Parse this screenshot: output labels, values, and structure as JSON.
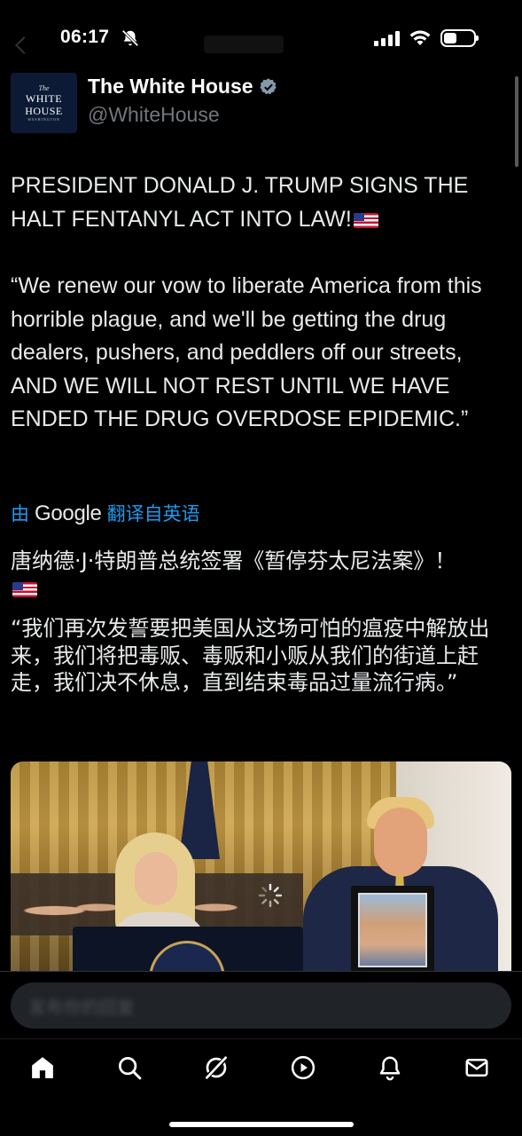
{
  "status_bar": {
    "time": "06:17",
    "icons": [
      "bell-off-icon",
      "signal-icon",
      "wifi-icon",
      "battery-icon"
    ]
  },
  "post": {
    "author": {
      "name": "The White House",
      "handle": "@WhiteHouse",
      "verified": true,
      "avatar_logo": {
        "line1": "The",
        "line2": "WHITE",
        "line3": "HOUSE",
        "line4": "WASHINGTON"
      }
    },
    "headline": "PRESIDENT DONALD J. TRUMP SIGNS THE HALT FENTANYL ACT INTO LAW!",
    "quote": "“We renew our vow to liberate America from this horrible plague, and we'll be getting the drug dealers, pushers, and peddlers off our streets, AND WE WILL NOT REST UNTIL WE HAVE ENDED THE DRUG OVERDOSE EPIDEMIC.”",
    "translation": {
      "prefix": "由",
      "provider": "Google",
      "suffix": "翻译自英语"
    },
    "translated_headline": "唐纳德·J·特朗普总统签署《暂停芬太尼法案》！",
    "translated_quote": "“我们再次发誓要把美国从这场可怕的瘟疫中解放出来，我们将把毒贩、毒贩和小贩从我们的街道上赶走，我们决不休息，直到结束毒品过量流行病。”"
  },
  "reply": {
    "placeholder": "发布你的回复"
  },
  "tab_bar": {
    "tabs": [
      {
        "icon": "home-icon",
        "active": true
      },
      {
        "icon": "search-icon",
        "active": false
      },
      {
        "icon": "grok-icon",
        "active": false
      },
      {
        "icon": "video-icon",
        "active": false
      },
      {
        "icon": "notifications-icon",
        "active": false
      },
      {
        "icon": "messages-icon",
        "active": false
      }
    ]
  },
  "colors": {
    "background": "#000000",
    "text": "#e7e9ea",
    "secondary_text": "#71767b",
    "link": "#1d9bf0",
    "verified": "#829aab"
  }
}
